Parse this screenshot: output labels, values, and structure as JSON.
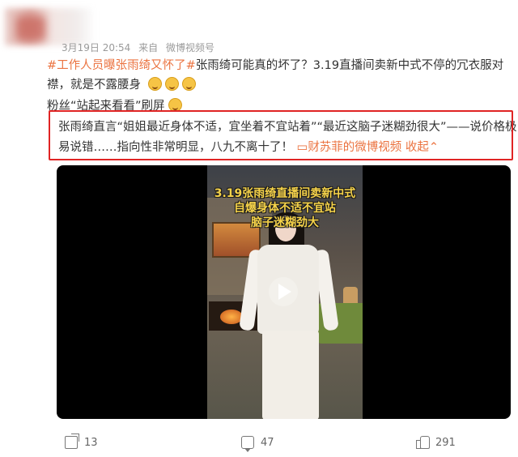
{
  "post": {
    "meta": {
      "date": "3月19日 20:54",
      "source_prefix": "来自",
      "source": "微博视频号"
    },
    "line1_topic": "#工作人员曝张雨绮又怀了#",
    "line1_rest": "张雨绮可能真的坏了？3.19直播间卖新中式不停的冗衣服对",
    "line2": "襟，就是不露腰身",
    "line3": "粉丝“站起来看看”刷屏",
    "line4": "张雨绮直言“姐姐最近身体不适，宜坐着不宜站着”“最近这脑子迷糊劲很大”——说价格极",
    "line5_text": "易说错……指向性非常明显，八九不离十了！",
    "line5_link": "财苏菲的微博视频",
    "line5_collapse": "收起"
  },
  "video": {
    "caption_lines": [
      "3.19张雨绮直播间卖新中式",
      "自爆身体不适不宜站",
      "脑子迷糊劲大"
    ]
  },
  "actions": {
    "share_count": "13",
    "comment_count": "47",
    "like_count": "291"
  },
  "colors": {
    "accent": "#eb7340",
    "highlight_border": "#e02424"
  },
  "icons": [
    "share-icon",
    "comment-icon",
    "like-icon",
    "play-icon",
    "emoji-icon",
    "video-link-icon"
  ]
}
